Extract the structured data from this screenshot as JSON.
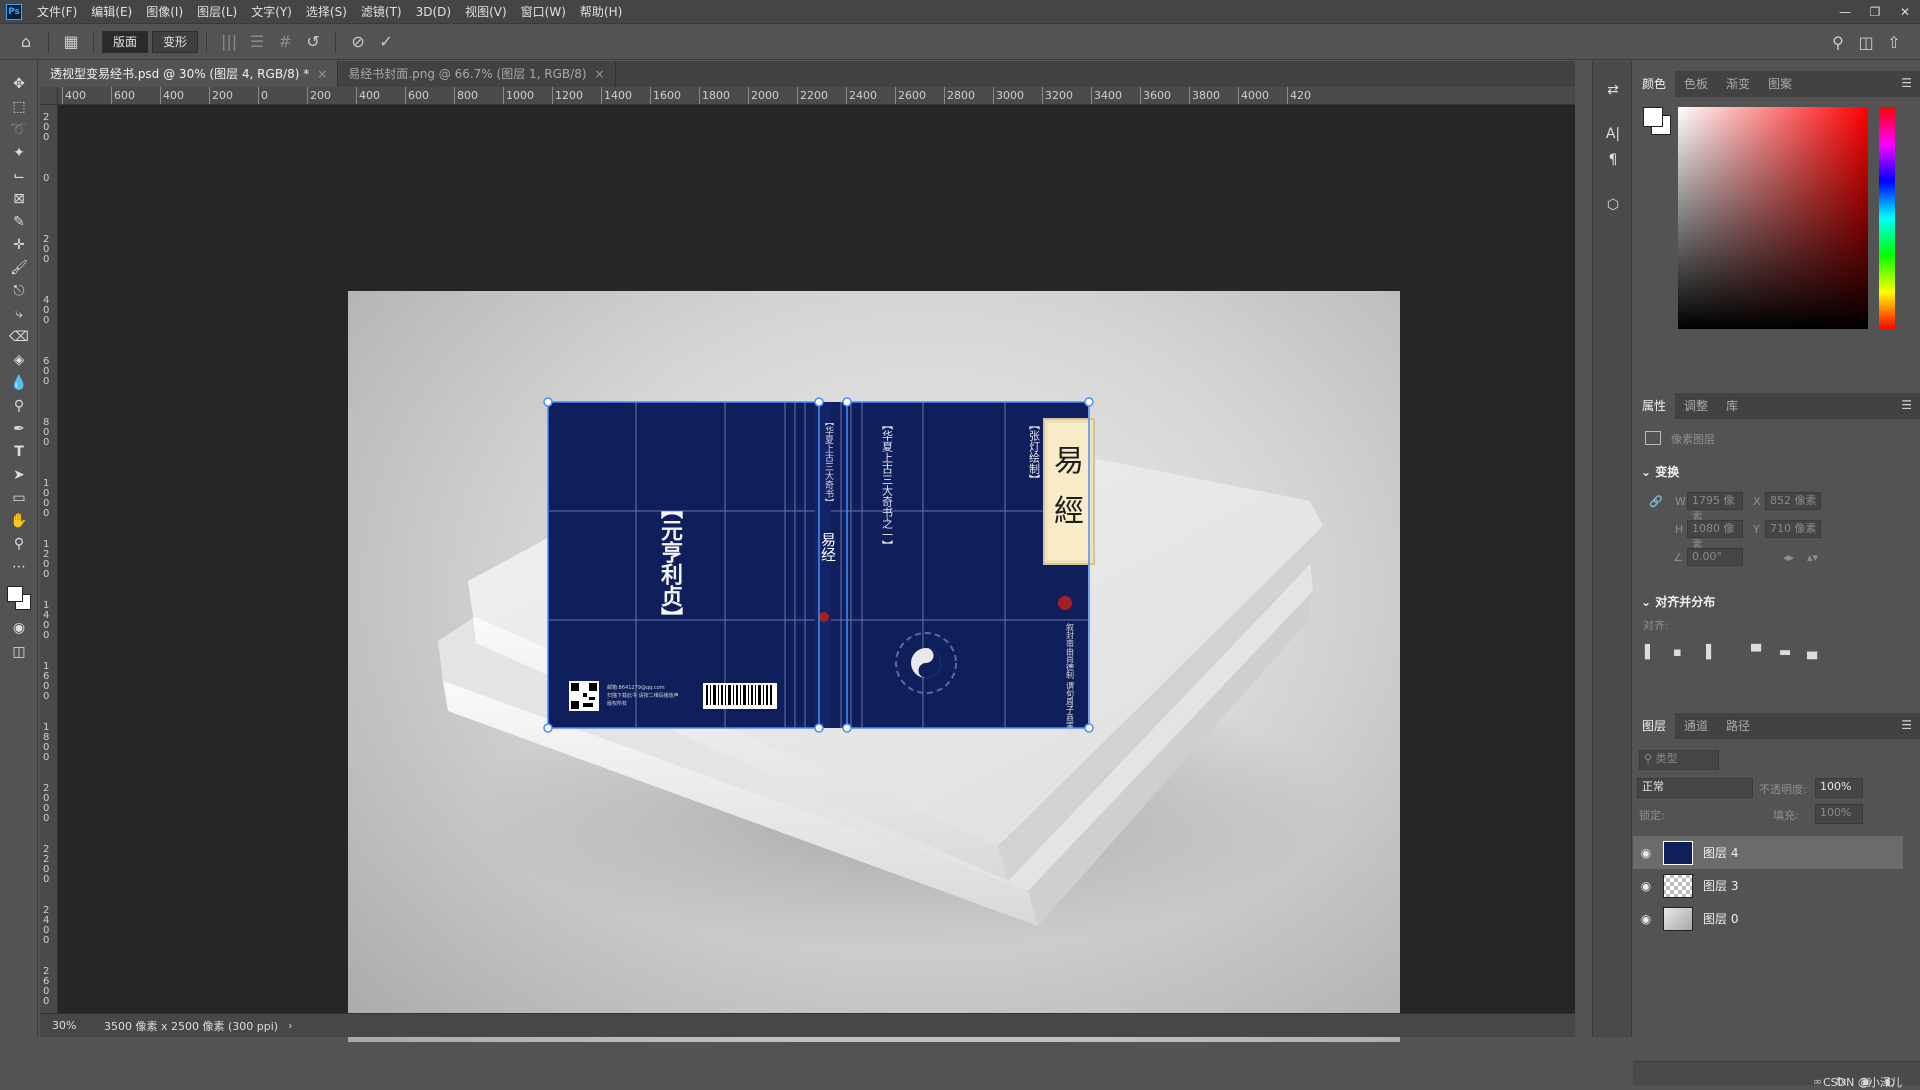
{
  "app": {
    "logo": "Ps",
    "menu": [
      "文件(F)",
      "编辑(E)",
      "图像(I)",
      "图层(L)",
      "文字(Y)",
      "选择(S)",
      "滤镜(T)",
      "3D(D)",
      "视图(V)",
      "窗口(W)",
      "帮助(H)"
    ]
  },
  "options": {
    "mode_label_1": "版面",
    "mode_label_2": "变形"
  },
  "tabs": [
    {
      "label": "透视型变易经书.psd @ 30% (图层 4, RGB/8) *",
      "close": "×"
    },
    {
      "label": "易经书封面.png @ 66.7% (图层 1, RGB/8)",
      "close": "×"
    }
  ],
  "ruler_top": [
    "400",
    "600",
    "400",
    "200",
    "0",
    "200",
    "400",
    "600",
    "800",
    "1000",
    "1200",
    "1400",
    "1600",
    "1800",
    "2000",
    "2200",
    "2400",
    "2600",
    "2800",
    "3000",
    "3200",
    "3400",
    "3600",
    "3800",
    "4000",
    "420"
  ],
  "ruler_left": [
    "200",
    "0",
    "200",
    "400",
    "600",
    "800",
    "1000",
    "1200",
    "1400",
    "1600",
    "1800",
    "2000",
    "2200",
    "2400",
    "2600"
  ],
  "book": {
    "back_title": "【元亨利贞】",
    "spine_text": "【华夏上古三大奇书】",
    "spine_title": "易经",
    "front_tagline": "【华夏上古三大奇书之一】",
    "front_subtitle": "【张灯绘制】",
    "front_title_1": "易",
    "front_title_2": "經",
    "front_poem": "叙封南由尚德制 谓旬周子商害周道",
    "back_info_1": "邮箱:8641279@qq.com",
    "back_info_2": "扫描下载此书 请按二维码播放声",
    "back_info_3": "版权所有"
  },
  "status": {
    "zoom": "30%",
    "doc_info": "3500 像素 x 2500 像素 (300 ppi)",
    "arrow": "›"
  },
  "panels": {
    "color_tabs": [
      "颜色",
      "色板",
      "渐变",
      "图案"
    ],
    "props_tabs": [
      "属性",
      "调整",
      "库"
    ],
    "props_type": "像素图层",
    "transform_title": "变换",
    "w_label": "W",
    "w_value": "1795 像素",
    "x_label": "X",
    "x_value": "852 像素",
    "h_label": "H",
    "h_value": "1080 像素",
    "y_label": "Y",
    "y_value": "710 像素",
    "angle_value": "0.00°",
    "align_title": "对齐并分布",
    "align_label": "对齐:",
    "layers_tabs": [
      "图层",
      "通道",
      "路径"
    ],
    "filter_placeholder": "类型",
    "blend_mode": "正常",
    "opacity_label": "不透明度:",
    "opacity_value": "100%",
    "lock_label": "锁定:",
    "fill_label": "填充:",
    "fill_value": "100%",
    "layers": [
      "图层 4",
      "图层 3",
      "图层 0"
    ],
    "watermark": "CSDN @小泽儿"
  },
  "colors": {
    "book_navy": "#0f1f5c",
    "transform_blue": "#4a8bff"
  }
}
